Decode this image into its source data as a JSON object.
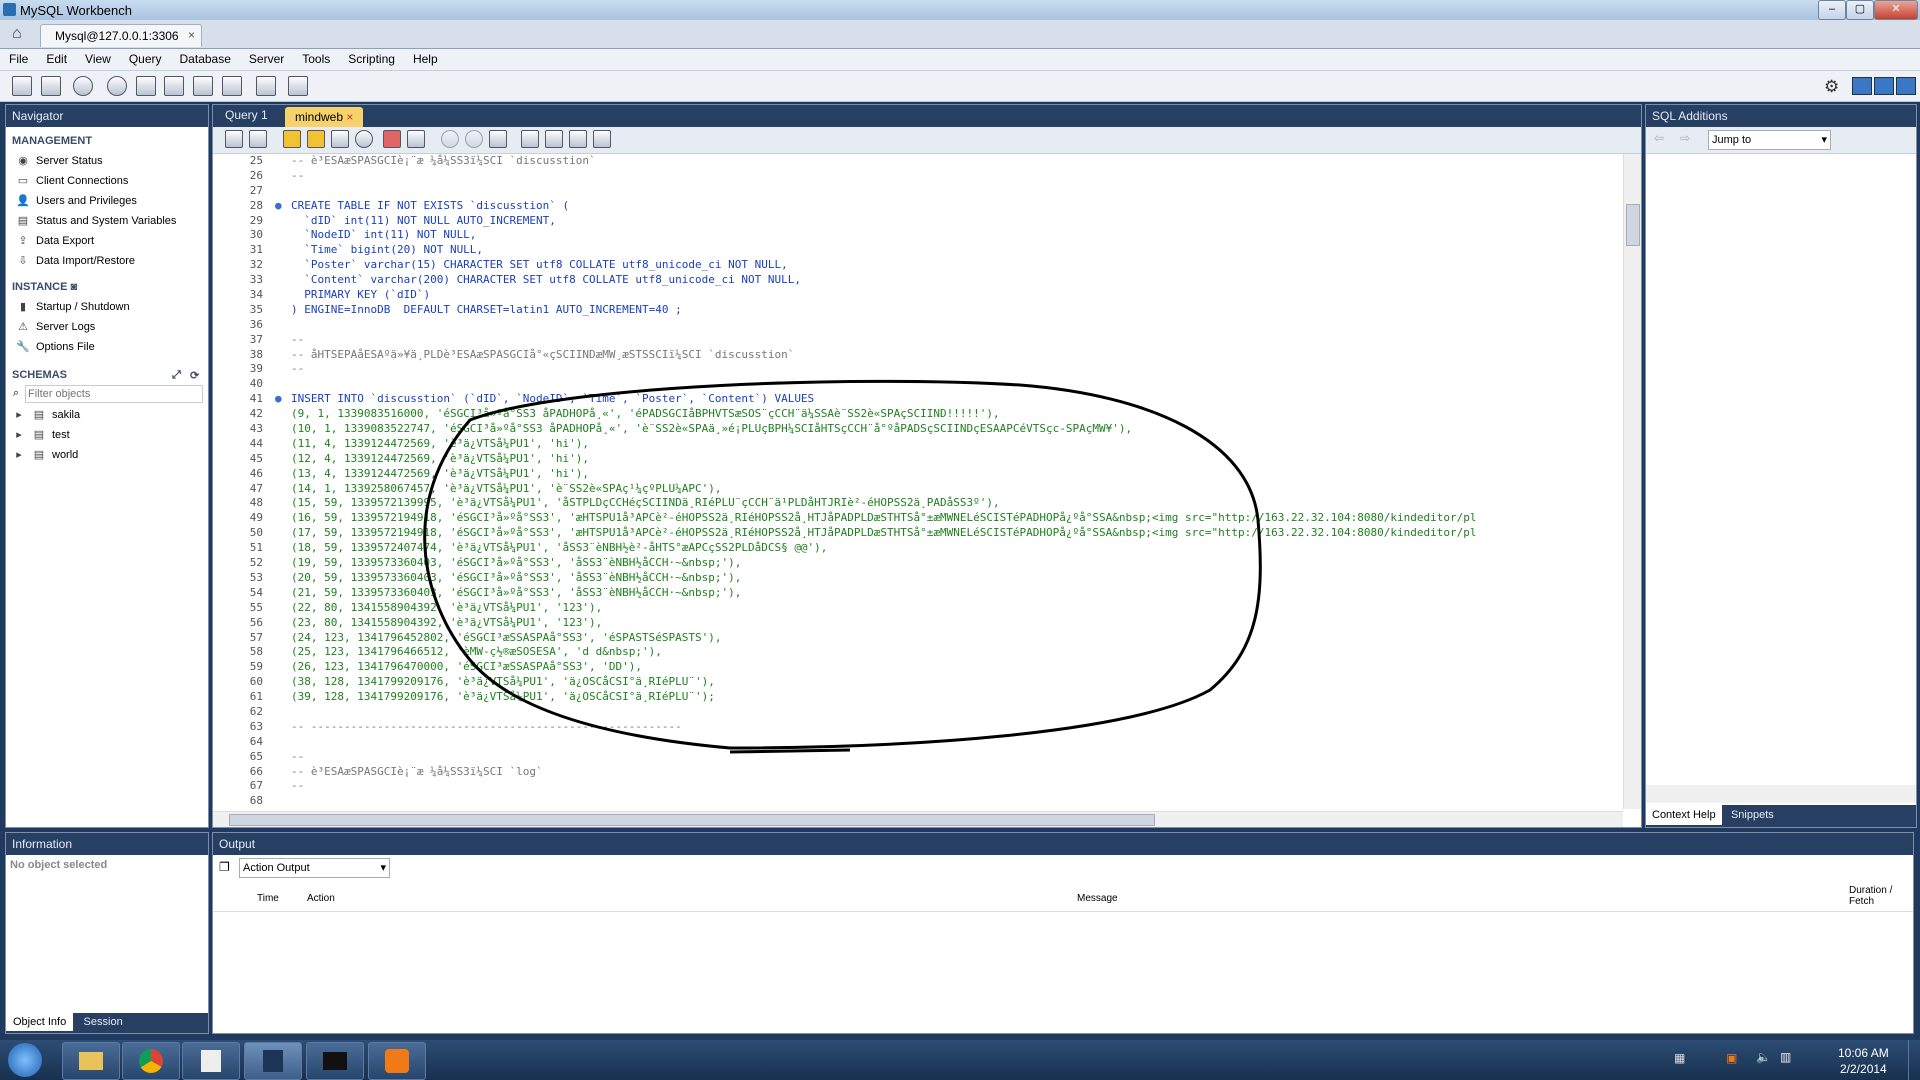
{
  "window": {
    "title": "MySQL Workbench",
    "connection_tab": "Mysql@127.0.0.1:3306",
    "close_glyph": "×"
  },
  "menu": [
    "File",
    "Edit",
    "View",
    "Query",
    "Database",
    "Server",
    "Tools",
    "Scripting",
    "Help"
  ],
  "navigator": {
    "title": "Navigator",
    "management_heading": "MANAGEMENT",
    "management": [
      "Server Status",
      "Client Connections",
      "Users and Privileges",
      "Status and System Variables",
      "Data Export",
      "Data Import/Restore"
    ],
    "instance_heading": "INSTANCE",
    "instance": [
      "Startup / Shutdown",
      "Server Logs",
      "Options File"
    ],
    "schemas_heading": "SCHEMAS",
    "filter_placeholder": "Filter objects",
    "schemas": [
      "sakila",
      "test",
      "world"
    ]
  },
  "information": {
    "title": "Information",
    "empty": "No object selected",
    "tabs": [
      "Object Info",
      "Session"
    ]
  },
  "editor": {
    "tabs": [
      "Query 1",
      "mindweb"
    ],
    "active_tab": "mindweb"
  },
  "sql_additions": {
    "title": "SQL Additions",
    "jump_to": "Jump to",
    "tabs": [
      "Context Help",
      "Snippets"
    ]
  },
  "output": {
    "title": "Output",
    "selector": "Action Output",
    "columns": [
      "Time",
      "Action",
      "Message",
      "Duration / Fetch"
    ]
  },
  "taskbar": {
    "time": "10:06 AM",
    "date": "2/2/2014"
  },
  "code_lines": [
    {
      "n": "25",
      "t": "-- è³ESAæSPASGCIè¡¨æ ¼å¼SS3ï¼SCI `discusstion`",
      "c": "cm"
    },
    {
      "n": "26",
      "t": "--",
      "c": "cm"
    },
    {
      "n": "27",
      "t": "",
      "c": ""
    },
    {
      "n": "28",
      "t": "CREATE TABLE IF NOT EXISTS `discusstion` (",
      "c": "kw"
    },
    {
      "n": "29",
      "t": "  `dID` int(11) NOT NULL AUTO_INCREMENT,",
      "c": "kw"
    },
    {
      "n": "30",
      "t": "  `NodeID` int(11) NOT NULL,",
      "c": "kw"
    },
    {
      "n": "31",
      "t": "  `Time` bigint(20) NOT NULL,",
      "c": "kw"
    },
    {
      "n": "32",
      "t": "  `Poster` varchar(15) CHARACTER SET utf8 COLLATE utf8_unicode_ci NOT NULL,",
      "c": "kw"
    },
    {
      "n": "33",
      "t": "  `Content` varchar(200) CHARACTER SET utf8 COLLATE utf8_unicode_ci NOT NULL,",
      "c": "kw"
    },
    {
      "n": "34",
      "t": "  PRIMARY KEY (`dID`)",
      "c": "kw"
    },
    {
      "n": "35",
      "t": ") ENGINE=InnoDB  DEFAULT CHARSET=latin1 AUTO_INCREMENT=40 ;",
      "c": "kw"
    },
    {
      "n": "36",
      "t": "",
      "c": ""
    },
    {
      "n": "37",
      "t": "--",
      "c": "cm"
    },
    {
      "n": "38",
      "t": "-- åHTSEPAåESAºä»¥ä¸PLDè³ESAæSPASGCIå°«çSCIINDæMW¸æSTSSCIï¼SCI `discusstion`",
      "c": "cm"
    },
    {
      "n": "39",
      "t": "--",
      "c": "cm"
    },
    {
      "n": "40",
      "t": "",
      "c": ""
    },
    {
      "n": "41",
      "t": "INSERT INTO `discusstion` (`dID`, `NodeID`, `Time`, `Poster`, `Content`) VALUES",
      "c": "kw"
    },
    {
      "n": "42",
      "t": "(9, 1, 1339083516000, 'éSGCI³å»ºå°SS3 åPADHOPå¸«', 'éPADSGCIåBPHVTSæSOS¨çCCH¨ä¼SSAè¨SS2è«SPAçSCIIND!!!!!'),",
      "c": "str"
    },
    {
      "n": "43",
      "t": "(10, 1, 1339083522747, 'éSGCI³å»ºå°SS3 åPADHOPå¸«', 'è¨SS2è«SPAä¸»é¡PLUçBPH¼SCIåHTSçCCH¨å°ºåPADSçSCIINDçESAAPCéVTSçc-SPAçMW¥'),",
      "c": "str"
    },
    {
      "n": "44",
      "t": "(11, 4, 1339124472569, 'è³ä¿VTSå¼PU1', 'hi'),",
      "c": "str"
    },
    {
      "n": "45",
      "t": "(12, 4, 1339124472569, 'è³ä¿VTSå¼PU1', 'hi'),",
      "c": "str"
    },
    {
      "n": "46",
      "t": "(13, 4, 1339124472569, 'è³ä¿VTSå¼PU1', 'hi'),",
      "c": "str"
    },
    {
      "n": "47",
      "t": "(14, 1, 1339258067457, 'è³ä¿VTSå¼PU1', 'è¨SS2è«SPAç¹¼çºPLU¼APC'),",
      "c": "str"
    },
    {
      "n": "48",
      "t": "(15, 59, 1339572139995, 'è³ä¿VTSå¼PU1', 'åSTPLDçCCHéçSCIINDä¸RIéPLU¨çCCH¨ä¹PLDåHTJRIè²-éHOPSS2ä¸PADåSS3º'),",
      "c": "str"
    },
    {
      "n": "49",
      "t": "(16, 59, 1339572194918, 'éSGCI³å»ºå°SS3', 'æHTSPU1å³APCè²-éHOPSS2ä¸RIéHOPSS2å¸HTJåPADPLDæSTHTSå°±æMWNELéSCISTéPADHOPå¿ºå°SSA&nbsp;<img src=\"http://163.22.32.104:8080/kindeditor/pl",
      "c": "str"
    },
    {
      "n": "50",
      "t": "(17, 59, 1339572194918, 'éSGCI³å»ºå°SS3', 'æHTSPU1å³APCè²-éHOPSS2ä¸RIéHOPSS2å¸HTJåPADPLDæSTHTSå°±æMWNELéSCISTéPADHOPå¿ºå°SSA&nbsp;<img src=\"http://163.22.32.104:8080/kindeditor/pl",
      "c": "str"
    },
    {
      "n": "51",
      "t": "(18, 59, 1339572407474, 'è³ä¿VTSå¼PU1', 'åSS3¨èNBH½è²-åHTS°æAPCçSS2PLDåDCS§ @@'),",
      "c": "str"
    },
    {
      "n": "52",
      "t": "(19, 59, 1339573360403, 'éSGCI³å»ºå°SS3', 'åSS3¨èNBH½åCCH·~&nbsp;'),",
      "c": "str"
    },
    {
      "n": "53",
      "t": "(20, 59, 1339573360403, 'éSGCI³å»ºå°SS3', 'åSS3¨èNBH½åCCH·~&nbsp;'),",
      "c": "str"
    },
    {
      "n": "54",
      "t": "(21, 59, 1339573360403, 'éSGCI³å»ºå°SS3', 'åSS3¨èNBH½åCCH·~&nbsp;'),",
      "c": "str"
    },
    {
      "n": "55",
      "t": "(22, 80, 1341558904392, 'è³ä¿VTSå¼PU1', '123'),",
      "c": "str"
    },
    {
      "n": "56",
      "t": "(23, 80, 1341558904392, 'è³ä¿VTSå¼PU1', '123'),",
      "c": "str"
    },
    {
      "n": "57",
      "t": "(24, 123, 1341796452802, 'éSGCI³æSSASPAå°SS3', 'éSPASTSéSPASTS'),",
      "c": "str"
    },
    {
      "n": "58",
      "t": "(25, 123, 1341796466512, 'èMW-ç½®æSOSESA', 'd d&nbsp;'),",
      "c": "str"
    },
    {
      "n": "59",
      "t": "(26, 123, 1341796470000, 'éSGCI³æSSASPAå°SS3', 'DD'),",
      "c": "str"
    },
    {
      "n": "60",
      "t": "(38, 128, 1341799209176, 'è³ä¿VTSå¼PU1', 'ä¿OSCåCSI°ä¸RIéPLU¨'),",
      "c": "str"
    },
    {
      "n": "61",
      "t": "(39, 128, 1341799209176, 'è³ä¿VTSå¼PU1', 'ä¿OSCåCSI°ä¸RIéPLU¨');",
      "c": "str"
    },
    {
      "n": "62",
      "t": "",
      "c": ""
    },
    {
      "n": "63",
      "t": "-- --------------------------------------------------------",
      "c": "cm"
    },
    {
      "n": "64",
      "t": "",
      "c": ""
    },
    {
      "n": "65",
      "t": "--",
      "c": "cm"
    },
    {
      "n": "66",
      "t": "-- è³ESAæSPASGCIè¡¨æ ¼å¼SS3ï¼SCI `log`",
      "c": "cm"
    },
    {
      "n": "67",
      "t": "--",
      "c": "cm"
    },
    {
      "n": "68",
      "t": "",
      "c": ""
    }
  ]
}
